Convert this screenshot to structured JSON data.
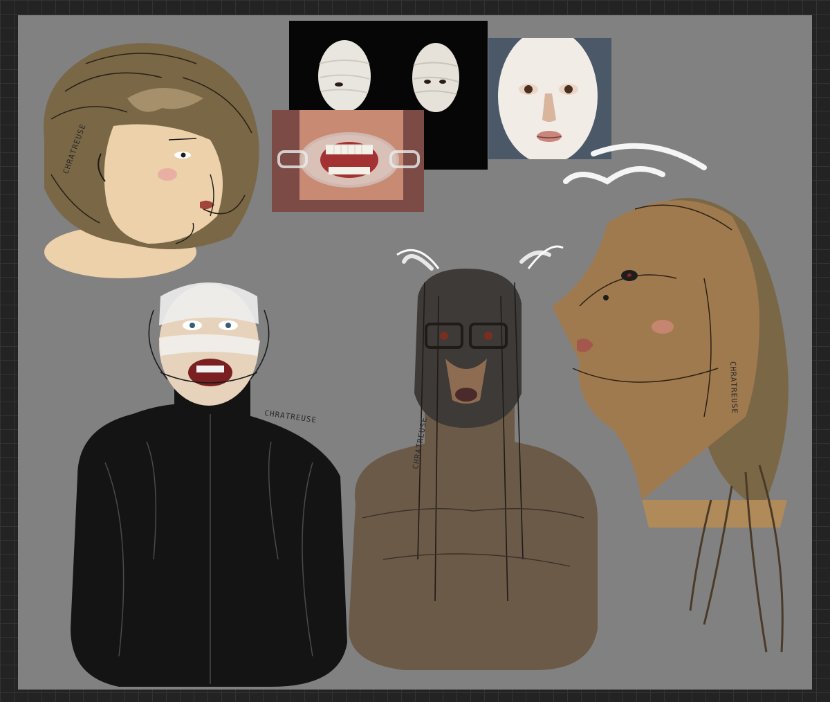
{
  "artwork": {
    "background_color": "#818181",
    "frame_color": "#232323",
    "signatures": [
      {
        "id": "sig-head-top-left",
        "text": "CHRATREUSE"
      },
      {
        "id": "sig-bandaged-figure",
        "text": "CHRATREUSE"
      },
      {
        "id": "sig-masked-figure",
        "text": "CHRATREUSE"
      },
      {
        "id": "sig-profile-head",
        "text": "CHRATREUSE"
      }
    ],
    "references": [
      {
        "id": "bandaged-faces-photo",
        "subject": "two bandaged faces on black"
      },
      {
        "id": "mouth-retractor-photo",
        "subject": "cheek retractor with teeth"
      },
      {
        "id": "white-mask-photo",
        "subject": "white plastic face mask"
      }
    ],
    "colors": {
      "hair_brown": "#7a6746",
      "skin_light": "#ecd1ab",
      "skin_tan": "#a07a4f",
      "skin_dark": "#6b5a48",
      "mask_dark": "#3d3a37",
      "clothing_black": "#141414"
    }
  }
}
